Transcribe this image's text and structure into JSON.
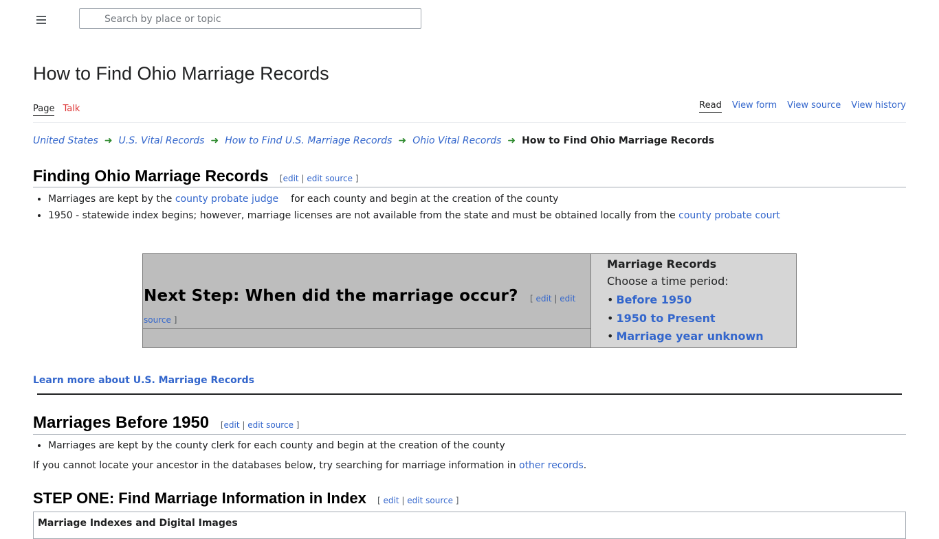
{
  "header": {
    "menu_icon": "hamburger-menu-icon",
    "search_placeholder": "Search by place or topic"
  },
  "page": {
    "title": "How to Find Ohio Marriage Records"
  },
  "tabs": {
    "left": [
      {
        "label": "Page",
        "active": true
      },
      {
        "label": "Talk",
        "active": false
      }
    ],
    "right": [
      {
        "label": "Read",
        "active": true
      },
      {
        "label": "View form",
        "active": false
      },
      {
        "label": "View source",
        "active": false
      },
      {
        "label": "View history",
        "active": false
      }
    ]
  },
  "breadcrumb": {
    "items": [
      "United States",
      "U.S. Vital Records",
      "How to Find U.S. Marriage Records",
      "Ohio Vital Records"
    ],
    "current": "How to Find Ohio Marriage Records",
    "arrow_icon": "green-arrow-right-icon"
  },
  "edit": {
    "open": "[",
    "edit": "edit",
    "sep": "|",
    "edit_source": "edit source",
    "close": "]"
  },
  "section1": {
    "heading": "Finding Ohio Marriage Records",
    "bullet1_pre": "Marriages are kept by the ",
    "bullet1_link": "county probate judge",
    "bullet1_post": "for each county and begin at the creation of the county",
    "bullet2_pre": "1950 - statewide index begins; however, marriage licenses are not available from the state and must be obtained locally from the ",
    "bullet2_link": "county probate court"
  },
  "next_step": {
    "heading": "Next Step: When did the marriage occur?",
    "edit_source_part1": "edit",
    "edit_source_part2": "source",
    "box_title": "Marriage Records",
    "box_subtitle": "Choose a time period:",
    "options": [
      "Before 1950",
      "1950 to Present",
      "Marriage year unknown"
    ]
  },
  "learn_more": "Learn more about U.S. Marriage Records",
  "section2": {
    "heading": "Marriages Before 1950",
    "bullet1": "Marriages are kept by the county clerk for each county and begin at the creation of the county",
    "para_pre": "If you cannot locate your ancestor in the databases below, try searching for marriage information in ",
    "para_link": "other records",
    "para_post": "."
  },
  "section3": {
    "heading": "STEP ONE: Find Marriage Information in Index",
    "table_title": "Marriage Indexes and Digital Images"
  },
  "colors": {
    "link": "#3366cc",
    "talk_red": "#dd3333",
    "arrow_green": "#2d8a2d",
    "nextstep_left_bg": "#bdbdbd",
    "nextstep_right_bg": "#d6d6d6"
  }
}
